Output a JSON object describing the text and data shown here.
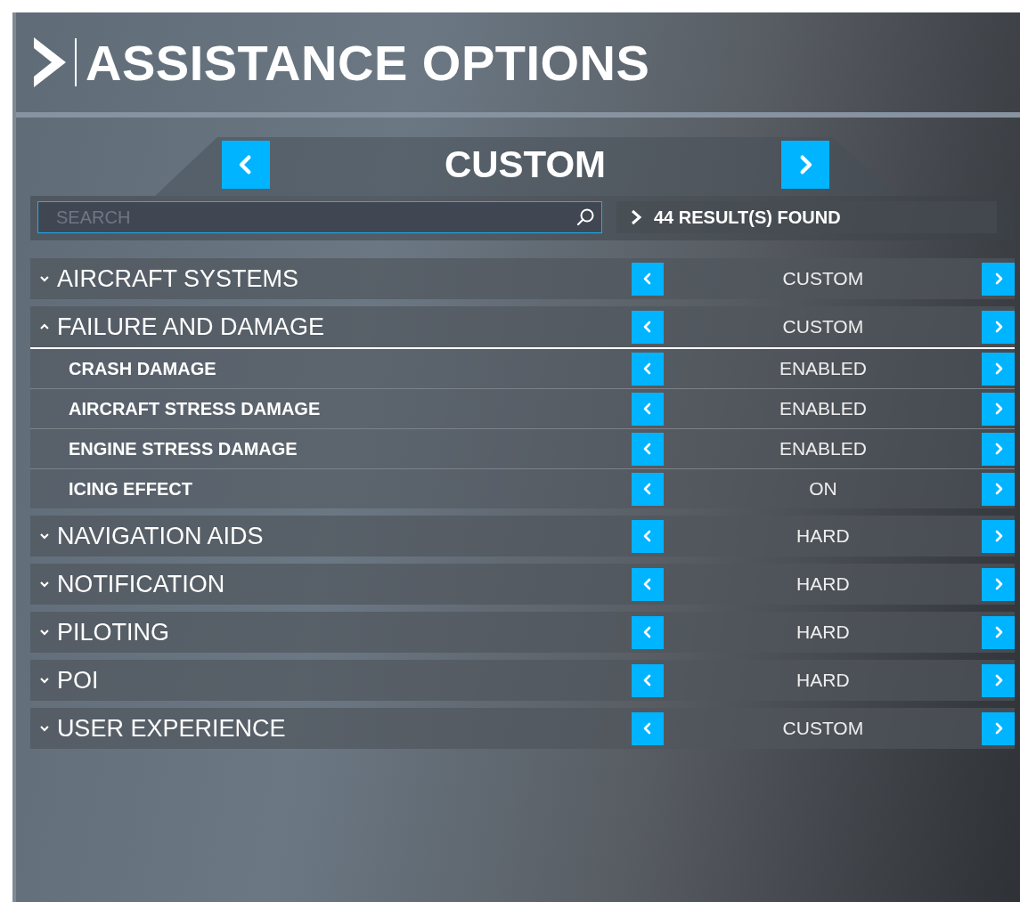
{
  "title": "ASSISTANCE OPTIONS",
  "preset": {
    "value": "CUSTOM"
  },
  "search": {
    "placeholder": "SEARCH"
  },
  "results": "44 RESULT(S) FOUND",
  "categories": [
    {
      "label": "AIRCRAFT SYSTEMS",
      "value": "CUSTOM",
      "expanded": false
    },
    {
      "label": "FAILURE AND DAMAGE",
      "value": "CUSTOM",
      "expanded": true,
      "children": [
        {
          "label": "CRASH DAMAGE",
          "value": "ENABLED"
        },
        {
          "label": "AIRCRAFT STRESS DAMAGE",
          "value": "ENABLED"
        },
        {
          "label": "ENGINE STRESS DAMAGE",
          "value": "ENABLED"
        },
        {
          "label": "ICING EFFECT",
          "value": "ON"
        }
      ]
    },
    {
      "label": "NAVIGATION AIDS",
      "value": "HARD",
      "expanded": false
    },
    {
      "label": "NOTIFICATION",
      "value": "HARD",
      "expanded": false
    },
    {
      "label": "PILOTING",
      "value": "HARD",
      "expanded": false
    },
    {
      "label": "POI",
      "value": "HARD",
      "expanded": false
    },
    {
      "label": "USER EXPERIENCE",
      "value": "CUSTOM",
      "expanded": false
    }
  ]
}
